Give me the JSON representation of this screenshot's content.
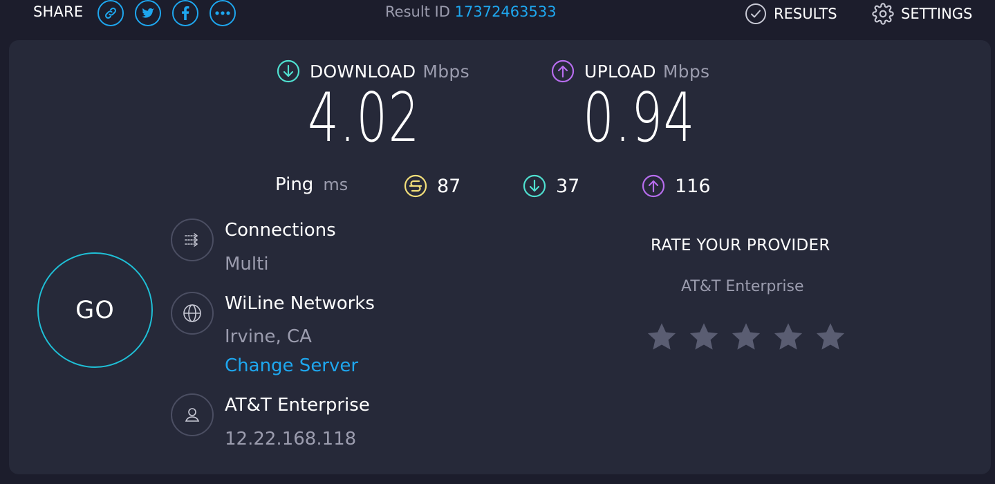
{
  "topbar": {
    "share_label": "SHARE",
    "share_buttons": [
      "link-icon",
      "twitter-icon",
      "facebook-icon",
      "more-icon"
    ],
    "result_id_label": "Result ID",
    "result_id": "17372463533",
    "results_label": "RESULTS",
    "settings_label": "SETTINGS"
  },
  "download": {
    "label": "DOWNLOAD",
    "unit": "Mbps",
    "value": "4.02",
    "color": "#4fe0d0"
  },
  "upload": {
    "label": "UPLOAD",
    "unit": "Mbps",
    "value": "0.94",
    "color": "#b76dee"
  },
  "ping": {
    "label": "Ping",
    "unit": "ms",
    "idle": "87",
    "download": "37",
    "upload": "116",
    "idle_color": "#f4e07a"
  },
  "go_label": "GO",
  "connections": {
    "title": "Connections",
    "value": "Multi"
  },
  "server": {
    "name": "WiLine Networks",
    "location": "Irvine, CA",
    "change_label": "Change Server"
  },
  "isp": {
    "name": "AT&T Enterprise",
    "ip": "12.22.168.118"
  },
  "rate": {
    "title": "RATE YOUR PROVIDER",
    "provider": "AT&T Enterprise",
    "stars_total": 5,
    "stars_selected": 0
  },
  "colors": {
    "accent": "#1ea7ef",
    "background": "#1c1d2c",
    "card": "#262939",
    "muted": "#9b9cae"
  }
}
